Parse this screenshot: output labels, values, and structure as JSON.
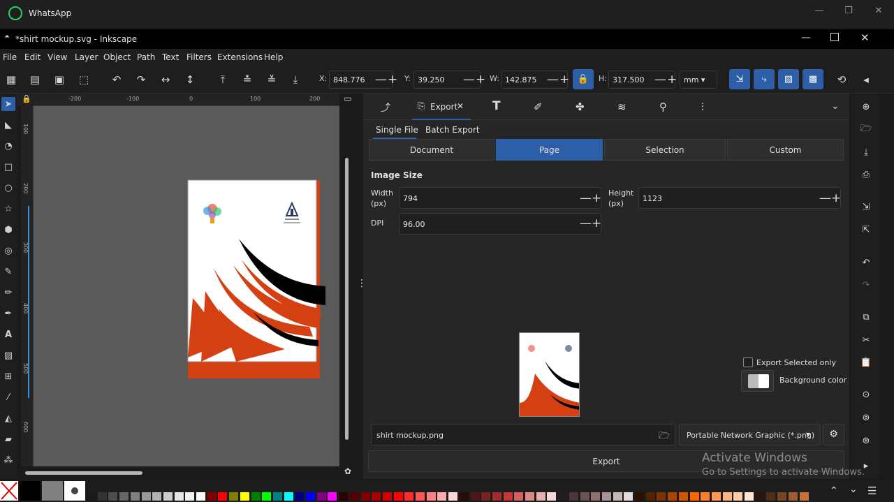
{
  "whatsapp": {
    "title": "WhatsApp"
  },
  "window": {
    "title": "*shirt mockup.svg - Inkscape"
  },
  "menu": [
    "File",
    "Edit",
    "View",
    "Layer",
    "Object",
    "Path",
    "Text",
    "Filters",
    "Extensions",
    "Help"
  ],
  "toolbar": {
    "x_label": "X:",
    "x_value": "848.776",
    "y_label": "Y:",
    "y_value": "39.250",
    "w_label": "W:",
    "w_value": "142.875",
    "h_label": "H:",
    "h_value": "317.500",
    "unit": "mm"
  },
  "ruler_top_ticks": [
    "-200",
    "-100",
    "0",
    "100",
    "200"
  ],
  "ruler_left_ticks": [
    "100",
    "200",
    "300",
    "400",
    "500",
    "600",
    "700"
  ],
  "export_panel": {
    "tab_label": "Export",
    "subtabs": [
      "Single File",
      "Batch Export"
    ],
    "area_buttons": [
      "Document",
      "Page",
      "Selection",
      "Custom"
    ],
    "active_area": "Page",
    "image_size_label": "Image Size",
    "width_label": "Width\n(px)",
    "width_value": "794",
    "height_label": "Height\n(px)",
    "height_value": "1123",
    "dpi_label": "DPI",
    "dpi_value": "96.00",
    "export_selected_label": "Export Selected only",
    "background_color_label": "Background color",
    "filename": "shirt mockup.png",
    "format": "Portable Network Graphic (*.png)",
    "export_button": "Export"
  },
  "watermark": {
    "line1": "Activate Windows",
    "line2": "Go to Settings to activate Windows."
  },
  "colors": {
    "accent": "#2c5fa8",
    "orange": "#d44012",
    "canvas": "#5a5a5a"
  }
}
